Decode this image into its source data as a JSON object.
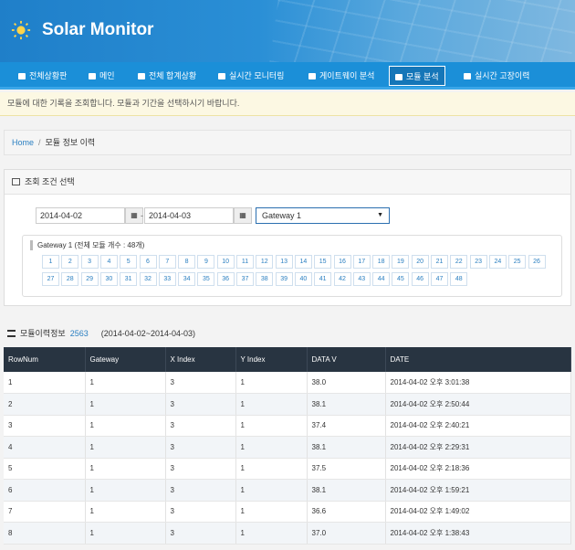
{
  "app": {
    "title": "Solar Monitor"
  },
  "nav": {
    "items": [
      {
        "label": "전체상황판",
        "active": false
      },
      {
        "label": "메인",
        "active": false
      },
      {
        "label": "전체 합계상황",
        "active": false
      },
      {
        "label": "실시간 모니터링",
        "active": false
      },
      {
        "label": "게이트웨이 분석",
        "active": false
      },
      {
        "label": "모듈 분석",
        "active": true
      },
      {
        "label": "실시간 고장이력",
        "active": false
      }
    ]
  },
  "notice": "모듈에 대한 기록을 조회합니다. 모듈과 기간을 선택하시기 바랍니다.",
  "breadcrumb": {
    "home": "Home",
    "current": "모듈 정보 이력"
  },
  "search": {
    "title": "조회 조건 선택",
    "start_date": "2014-04-02",
    "end_date": "2014-04-03",
    "separator": "-",
    "gateway_selected": "Gateway 1",
    "gateway_info": "Gateway 1 (전체 모듈 개수 : 48개)",
    "modules": [
      "1",
      "2",
      "3",
      "4",
      "5",
      "6",
      "7",
      "8",
      "9",
      "10",
      "11",
      "12",
      "13",
      "14",
      "15",
      "16",
      "17",
      "18",
      "19",
      "20",
      "21",
      "22",
      "23",
      "24",
      "25",
      "26",
      "27",
      "28",
      "29",
      "30",
      "31",
      "32",
      "33",
      "34",
      "35",
      "36",
      "37",
      "38",
      "39",
      "40",
      "41",
      "42",
      "43",
      "44",
      "45",
      "46",
      "47",
      "48"
    ]
  },
  "list": {
    "title": "모듈이력정보",
    "count": "2563",
    "range": "(2014-04-02~2014-04-03)",
    "columns": [
      "RowNum",
      "Gateway",
      "X Index",
      "Y Index",
      "DATA V",
      "DATE"
    ],
    "rows": [
      [
        "1",
        "1",
        "3",
        "1",
        "38.0",
        "2014-04-02 오후 3:01:38"
      ],
      [
        "2",
        "1",
        "3",
        "1",
        "38.1",
        "2014-04-02 오후 2:50:44"
      ],
      [
        "3",
        "1",
        "3",
        "1",
        "37.4",
        "2014-04-02 오후 2:40:21"
      ],
      [
        "4",
        "1",
        "3",
        "1",
        "38.1",
        "2014-04-02 오후 2:29:31"
      ],
      [
        "5",
        "1",
        "3",
        "1",
        "37.5",
        "2014-04-02 오후 2:18:36"
      ],
      [
        "6",
        "1",
        "3",
        "1",
        "38.1",
        "2014-04-02 오후 1:59:21"
      ],
      [
        "7",
        "1",
        "3",
        "1",
        "36.6",
        "2014-04-02 오후 1:49:02"
      ],
      [
        "8",
        "1",
        "3",
        "1",
        "37.0",
        "2014-04-02 오후 1:38:43"
      ]
    ]
  }
}
